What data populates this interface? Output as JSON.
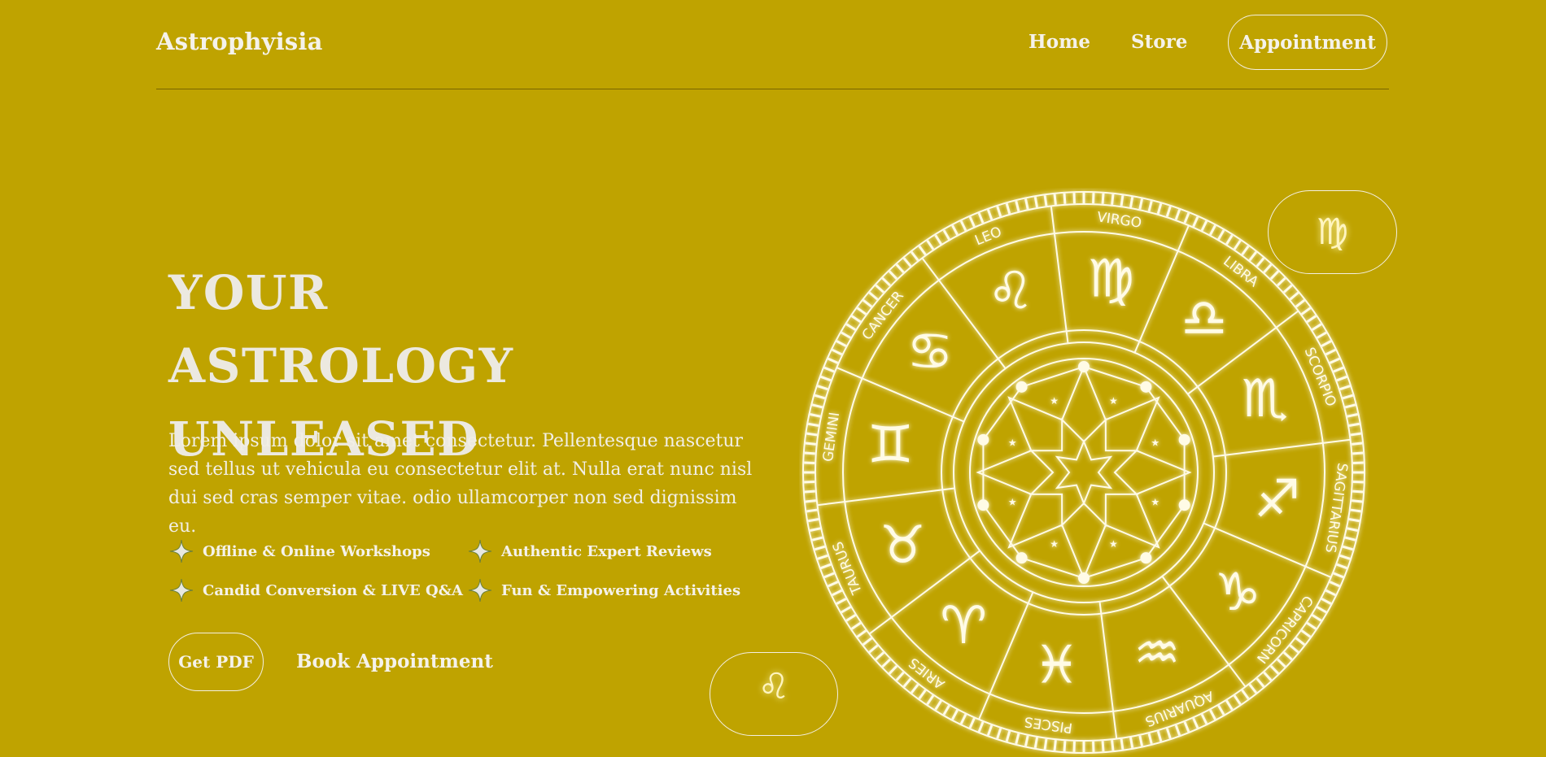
{
  "header": {
    "brand": "Astrophyisia",
    "nav": {
      "home": "Home",
      "store": "Store",
      "appointment": "Appointment"
    }
  },
  "hero": {
    "title_line1": "YOUR ASTROLOGY",
    "title_line2": "UNLEASED",
    "description": "Lorem ipsum dolor sit amet consectetur. Pellentesque nascetur sed tellus ut vehicula eu consectetur elit at. Nulla erat nunc nisl dui sed cras semper vitae. odio ullamcorper non sed dignissim eu.",
    "features": [
      "Offline & Online Workshops",
      "Authentic Expert Reviews",
      "Candid Conversion & LIVE Q&A",
      "Fun & Empowering Activities"
    ],
    "get_pdf": "Get PDF",
    "book_appointment": "Book Appointment"
  },
  "zodiac": {
    "signs": [
      {
        "name": "LEO",
        "glyph": "♌"
      },
      {
        "name": "VIRGO",
        "glyph": "♍"
      },
      {
        "name": "LIBRA",
        "glyph": "♎"
      },
      {
        "name": "SCORPIO",
        "glyph": "♏"
      },
      {
        "name": "SAGITTARIUS",
        "glyph": "♐"
      },
      {
        "name": "CAPRICORN",
        "glyph": "♑"
      },
      {
        "name": "AQUARIUS",
        "glyph": "♒"
      },
      {
        "name": "PISCES",
        "glyph": "♓"
      },
      {
        "name": "ARIES",
        "glyph": "♈"
      },
      {
        "name": "TAURUS",
        "glyph": "♉"
      },
      {
        "name": "GEMINI",
        "glyph": "♊"
      },
      {
        "name": "CANCER",
        "glyph": "♋"
      }
    ],
    "pill_top_glyph": "♍",
    "pill_bottom_glyph": "♌"
  },
  "colors": {
    "background": "#bfa300",
    "text": "#f2efe6",
    "glow": "#fff7b0"
  },
  "icons": {
    "feature_bullet": "four-point-star-icon"
  }
}
